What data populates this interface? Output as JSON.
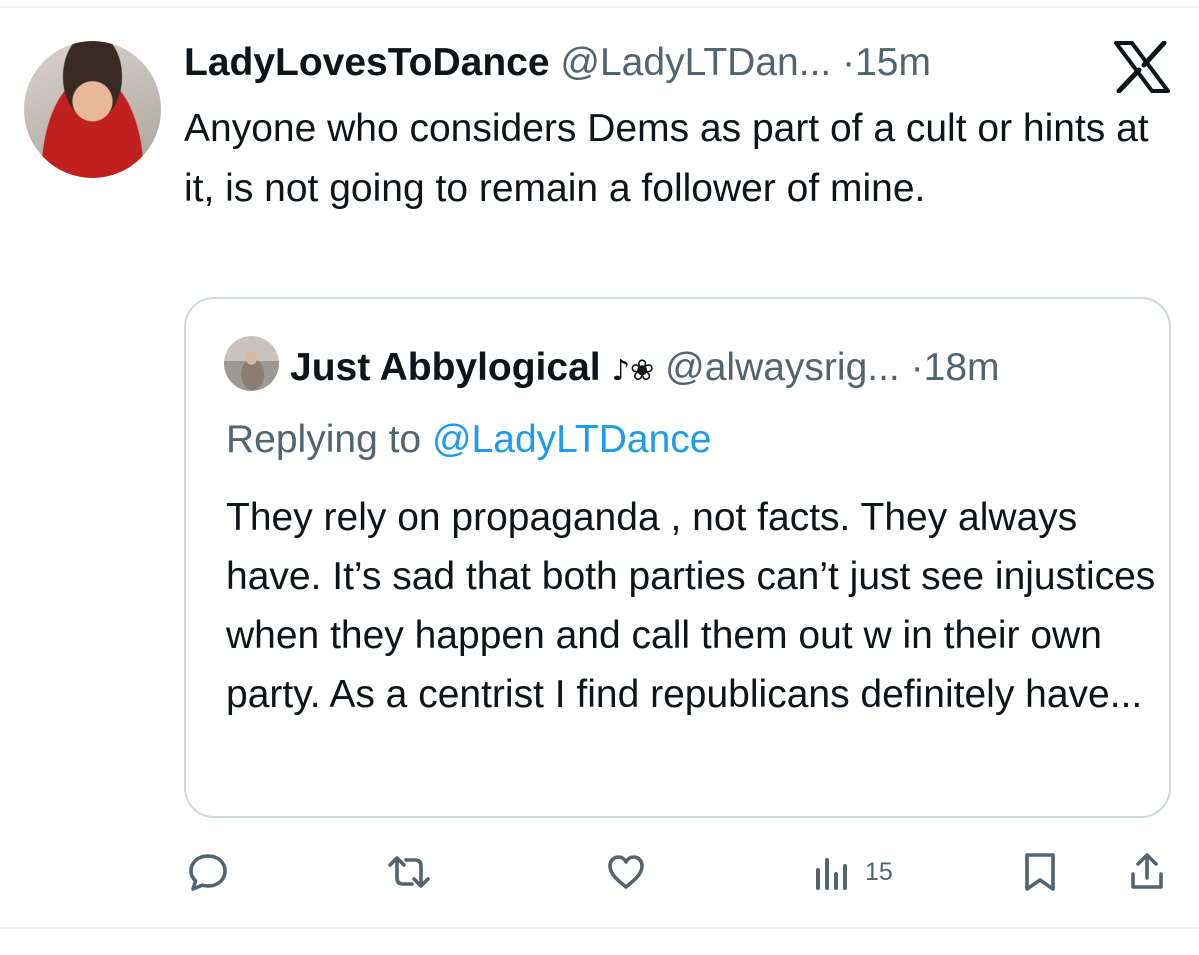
{
  "post": {
    "display_name": "LadyLovesToDance",
    "handle": "@LadyLTDan...",
    "separator": "·",
    "time": "15m",
    "text": "Anyone who considers Dems as part of a cult or hints at it, is not going to remain a follower of mine."
  },
  "quote": {
    "display_name": "Just Abbylogical",
    "name_emoji": "♪❀",
    "handle": "@alwaysrig...",
    "separator": "·",
    "time": "18m",
    "replying_prefix": "Replying to",
    "replying_handle": "@LadyLTDance",
    "text": "They rely on propaganda , not facts. They always have. It’s sad that both parties can’t just see injustices when they happen and call them out w in their own party. As a centrist I find republicans definitely have..."
  },
  "actions": {
    "views_count": "15"
  },
  "icons": {
    "platform": "x-logo-icon",
    "reply": "reply-icon",
    "repost": "repost-icon",
    "like": "like-icon",
    "views": "views-icon",
    "bookmark": "bookmark-icon",
    "share": "share-icon"
  },
  "colors": {
    "text": "#0f1419",
    "muted": "#536471",
    "link": "#1d9bf0",
    "border": "#cfd9de"
  }
}
